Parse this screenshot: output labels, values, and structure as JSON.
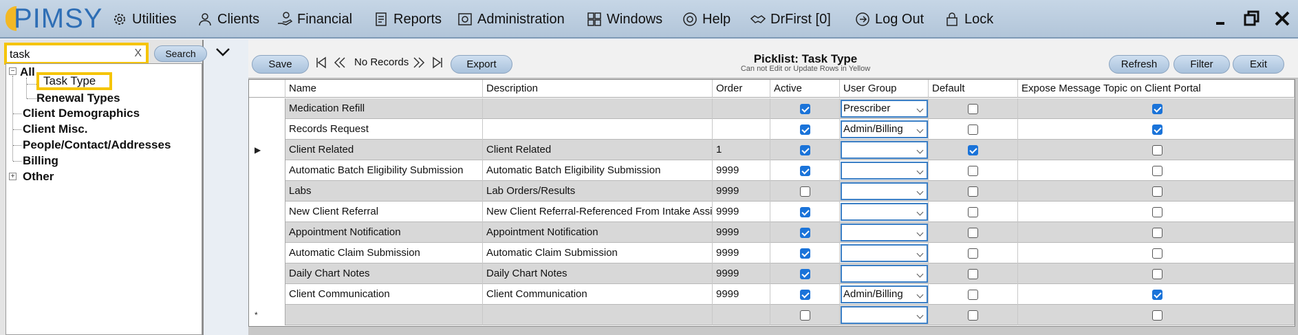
{
  "app": {
    "logo_text": "PIMSY"
  },
  "menu": {
    "items": [
      {
        "label": "Utilities",
        "icon": "gear-icon"
      },
      {
        "label": "Clients",
        "icon": "person-icon"
      },
      {
        "label": "Financial",
        "icon": "hand-coin-icon"
      },
      {
        "label": "Reports",
        "icon": "report-icon"
      },
      {
        "label": "Administration",
        "icon": "admin-icon"
      },
      {
        "label": "Windows",
        "icon": "windows-grid-icon"
      },
      {
        "label": "Help",
        "icon": "lifebuoy-icon"
      },
      {
        "label": "DrFirst [0]",
        "icon": "handshake-icon"
      },
      {
        "label": "Log Out",
        "icon": "logout-icon"
      },
      {
        "label": "Lock",
        "icon": "lock-icon"
      }
    ]
  },
  "search": {
    "value": "task",
    "clear_label": "X",
    "button_label": "Search"
  },
  "tree": {
    "all_label": "All",
    "selected_label": "Task Type",
    "renewal_label": "Renewal Types",
    "categories": [
      "Client Demographics",
      "Client Misc.",
      "People/Contact/Addresses",
      "Billing"
    ],
    "other_label": "Other"
  },
  "toolbar": {
    "save_label": "Save",
    "records_label": "No Records",
    "export_label": "Export",
    "title": "Picklist: Task Type",
    "subtitle": "Can not Edit or Update Rows in Yellow",
    "refresh_label": "Refresh",
    "filter_label": "Filter",
    "exit_label": "Exit"
  },
  "grid": {
    "columns": [
      "Name",
      "Description",
      "Order",
      "Active",
      "User Group",
      "Default",
      "Expose Message Topic on Client Portal"
    ],
    "rows": [
      {
        "name": "Medication Refill",
        "description": "",
        "order": "",
        "active": true,
        "user_group": "Prescriber",
        "default": false,
        "expose": true
      },
      {
        "name": "Records Request",
        "description": "",
        "order": "",
        "active": true,
        "user_group": "Admin/Billing",
        "default": false,
        "expose": true
      },
      {
        "name": "Client Related",
        "description": "Client Related",
        "order": "1",
        "active": true,
        "user_group": "",
        "default": true,
        "expose": false
      },
      {
        "name": "Automatic Batch Eligibility Submission",
        "description": "Automatic Batch Eligibility Submission",
        "order": "9999",
        "active": true,
        "user_group": "",
        "default": false,
        "expose": false
      },
      {
        "name": "Labs",
        "description": "Lab Orders/Results",
        "order": "9999",
        "active": false,
        "user_group": "",
        "default": false,
        "expose": false
      },
      {
        "name": "New Client Referral",
        "description": "New Client Referral-Referenced From Intake Assistant",
        "order": "9999",
        "active": true,
        "user_group": "",
        "default": false,
        "expose": false
      },
      {
        "name": "Appointment Notification",
        "description": "Appointment Notification",
        "order": "9999",
        "active": true,
        "user_group": "",
        "default": false,
        "expose": false
      },
      {
        "name": "Automatic Claim Submission",
        "description": "Automatic Claim Submission",
        "order": "9999",
        "active": true,
        "user_group": "",
        "default": false,
        "expose": false
      },
      {
        "name": "Daily Chart Notes",
        "description": "Daily Chart Notes",
        "order": "9999",
        "active": true,
        "user_group": "",
        "default": false,
        "expose": false
      },
      {
        "name": "Client Communication",
        "description": "Client Communication",
        "order": "9999",
        "active": true,
        "user_group": "Admin/Billing",
        "default": false,
        "expose": true
      },
      {
        "name": "",
        "description": "",
        "order": "",
        "active": false,
        "user_group": "",
        "default": false,
        "expose": false
      }
    ],
    "current_row_marker": "▶",
    "new_row_marker": "*",
    "current_row_index": 2
  },
  "colors": {
    "accent": "#1a73d9",
    "highlight": "#f5c400",
    "menubar": "#b8cade",
    "logo": "#2e6eb5"
  }
}
